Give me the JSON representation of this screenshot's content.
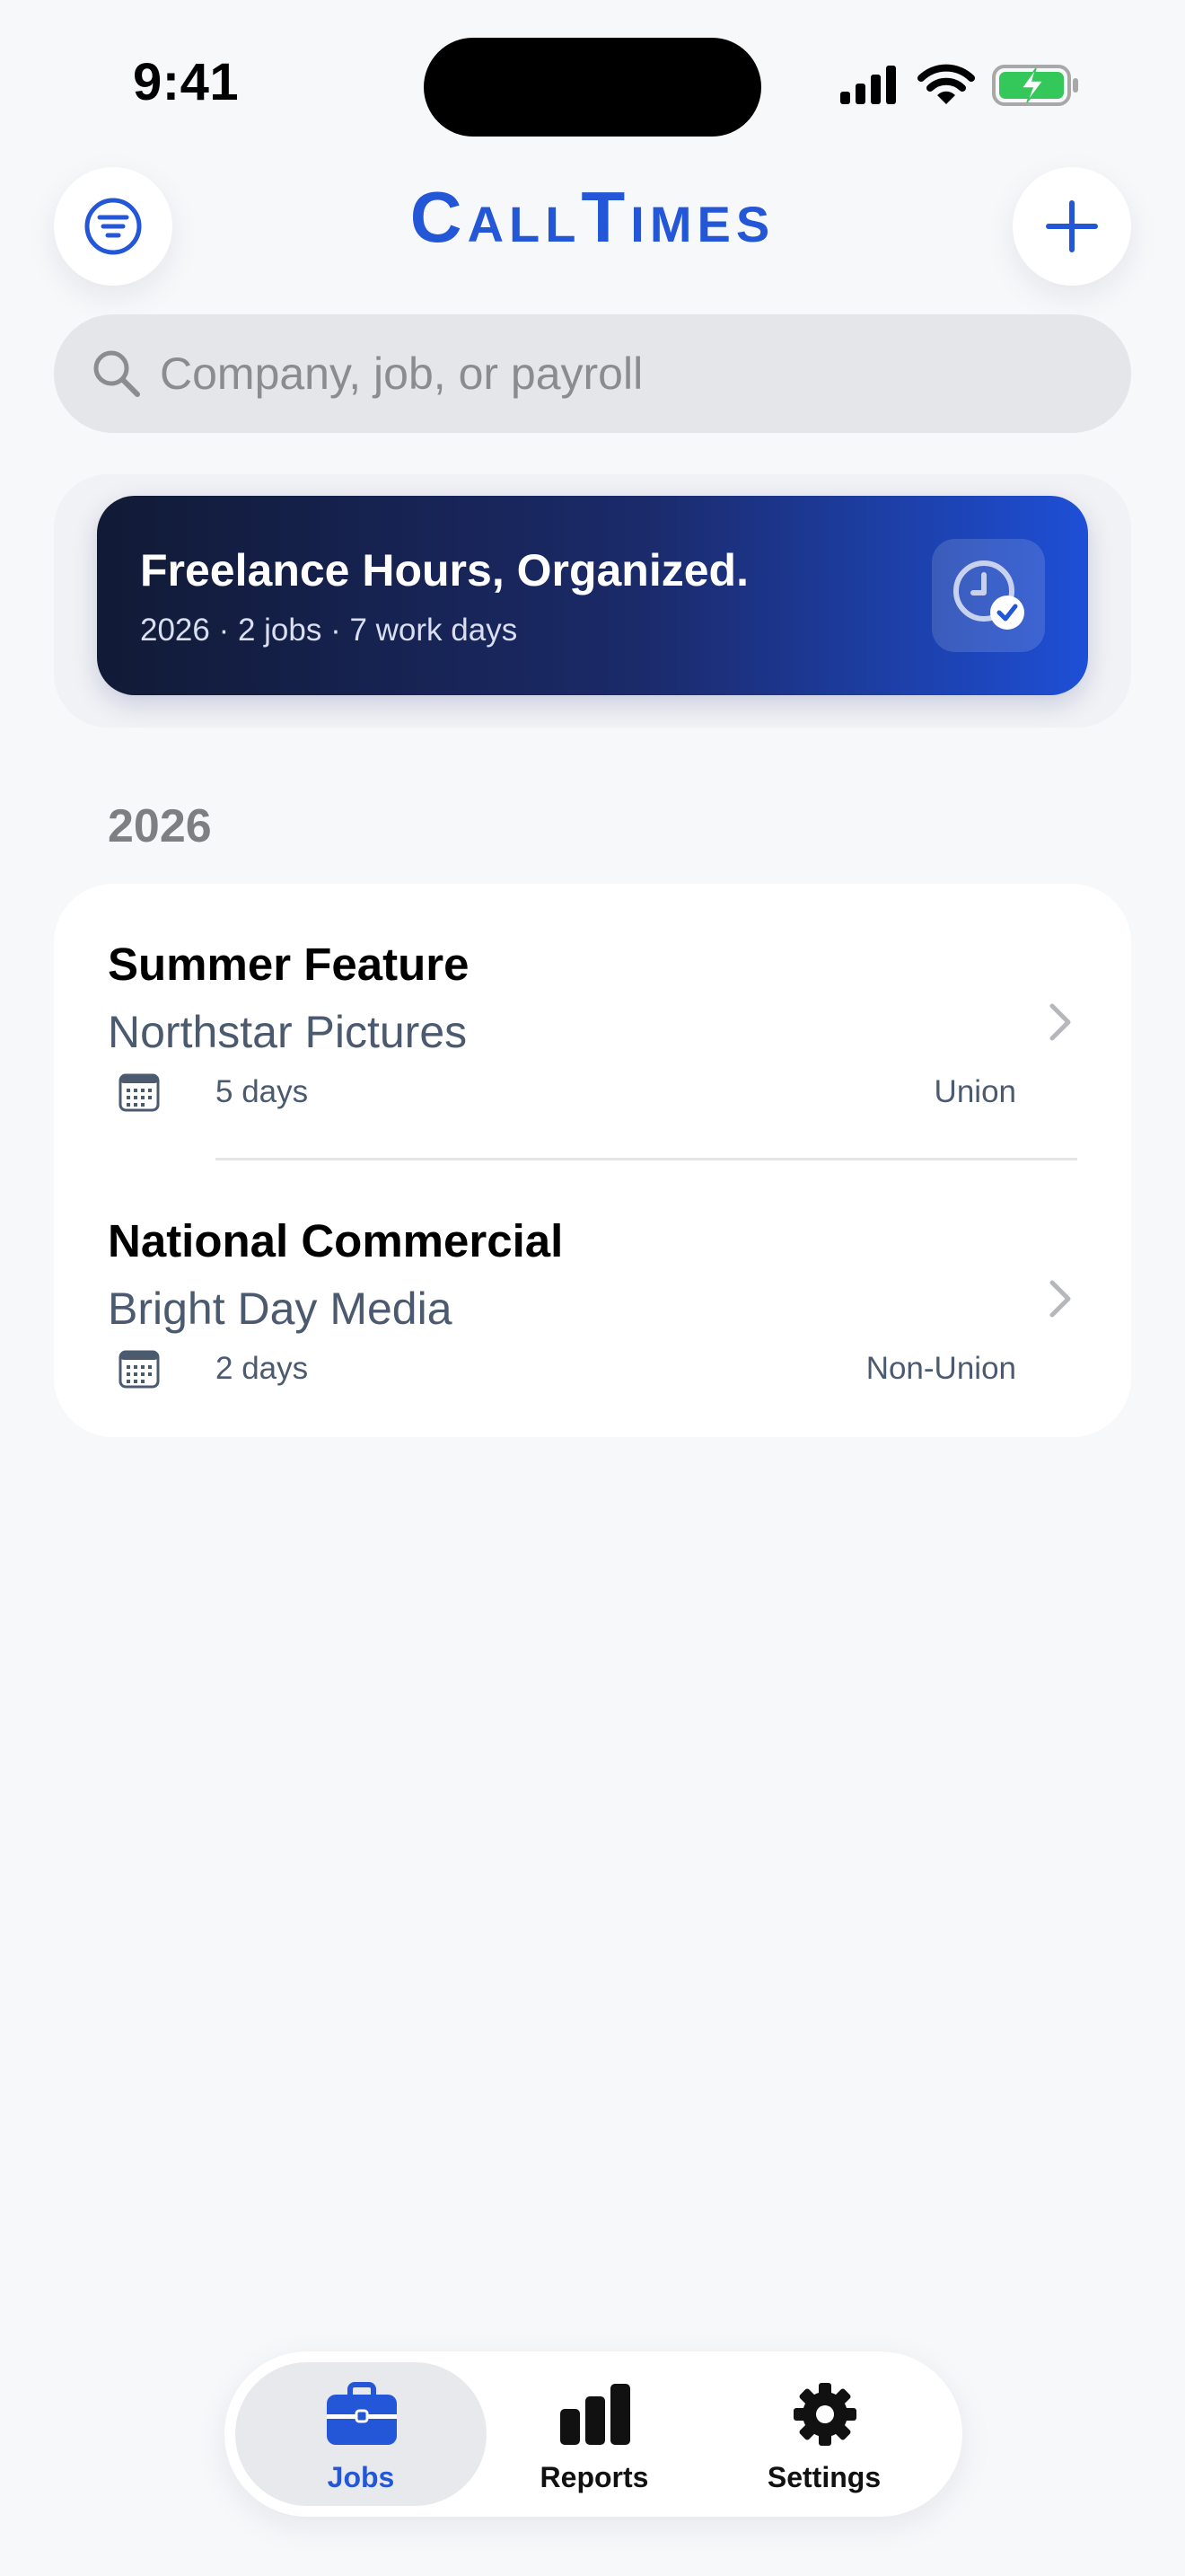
{
  "status_bar": {
    "time": "9:41"
  },
  "header": {
    "title": "CallTimes",
    "filter_icon": "filter-lines-icon",
    "add_icon": "plus-icon"
  },
  "search": {
    "placeholder": "Company, job, or payroll",
    "value": ""
  },
  "hero": {
    "title": "Freelance Hours, Organized.",
    "subtitle": "2026 · 2 jobs · 7 work days",
    "icon": "clock-check-icon"
  },
  "section": {
    "year": "2026",
    "jobs": [
      {
        "title": "Summer Feature",
        "company": "Northstar Pictures",
        "days": "5 days",
        "type": "Union"
      },
      {
        "title": "National Commercial",
        "company": "Bright Day Media",
        "days": "2 days",
        "type": "Non-Union"
      }
    ]
  },
  "tabbar": {
    "tabs": [
      {
        "label": "Jobs",
        "icon": "briefcase-icon",
        "active": true
      },
      {
        "label": "Reports",
        "icon": "bar-chart-icon",
        "active": false
      },
      {
        "label": "Settings",
        "icon": "gear-icon",
        "active": false
      }
    ]
  },
  "colors": {
    "accent": "#2456d8",
    "background": "#f7f8fa",
    "hero_start": "#111a35",
    "hero_end": "#1e4fd6",
    "battery": "#34c759"
  }
}
